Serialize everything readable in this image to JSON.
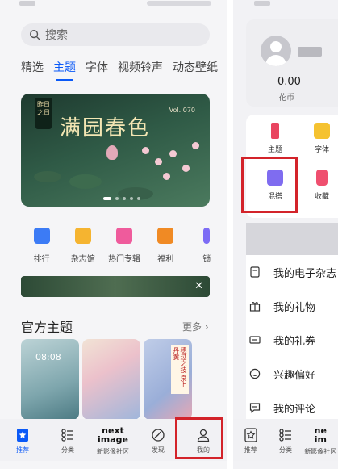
{
  "left": {
    "search": {
      "placeholder": "搜索"
    },
    "tabs": [
      {
        "label": "精选",
        "active": false
      },
      {
        "label": "主题",
        "active": true
      },
      {
        "label": "字体",
        "active": false
      },
      {
        "label": "视频铃声",
        "active": false
      },
      {
        "label": "动态壁纸",
        "active": false
      }
    ],
    "banner": {
      "tag": "昨日之日",
      "title": "满园春色",
      "volume": "Vol. 070",
      "page_count": 5,
      "active_page": 1
    },
    "shortcuts": [
      {
        "label": "排行",
        "icon": "ranking-icon",
        "color": "#3c7bf5"
      },
      {
        "label": "杂志馆",
        "icon": "magazine-icon",
        "color": "#f5b430"
      },
      {
        "label": "热门专辑",
        "icon": "album-icon",
        "color": "#ef5b9c"
      },
      {
        "label": "福利",
        "icon": "gift-icon",
        "color": "#f08a24"
      },
      {
        "label": "锁",
        "icon": "lock-icon",
        "color": "#7d6cf5"
      }
    ],
    "promo_strip": {
      "text": ""
    },
    "official": {
      "title": "官方主题",
      "more": "更多",
      "card1_clock": "08:08",
      "card3_poem": "穗过之技 泉上丹黄"
    },
    "bottom_nav": [
      {
        "label": "推荐",
        "icon": "recommend-icon",
        "active": true
      },
      {
        "label": "分类",
        "icon": "category-icon",
        "active": false
      },
      {
        "label": "新影像社区",
        "icon": "next-image-logo",
        "logo": "next\nimage",
        "active": false
      },
      {
        "label": "发现",
        "icon": "discover-icon",
        "active": false
      },
      {
        "label": "我的",
        "icon": "person-icon",
        "active": false
      }
    ]
  },
  "right": {
    "profile": {
      "coins_value": "0.00",
      "coins_label": "花币"
    },
    "grid": [
      {
        "label": "主题",
        "icon": "brush-icon",
        "color": "#e94560"
      },
      {
        "label": "字体",
        "icon": "font-icon",
        "color": "#f5c230"
      },
      {
        "label": "混搭",
        "icon": "mix-icon",
        "color": "#7f6cf0"
      },
      {
        "label": "收藏",
        "icon": "favorite-icon",
        "color": "#ef4f6f"
      }
    ],
    "menu": [
      {
        "label": "我的电子杂志",
        "icon": "ebook-icon"
      },
      {
        "label": "我的礼物",
        "icon": "gift-icon"
      },
      {
        "label": "我的礼券",
        "icon": "coupon-icon"
      },
      {
        "label": "兴趣偏好",
        "icon": "smile-icon"
      },
      {
        "label": "我的评论",
        "icon": "comment-icon"
      }
    ],
    "bottom_nav": [
      {
        "label": "推荐",
        "icon": "recommend-icon"
      },
      {
        "label": "分类",
        "icon": "category-icon"
      },
      {
        "label": "新影像社区",
        "icon": "next-image-logo",
        "logo": "next\nimage"
      }
    ]
  },
  "highlight_color": "#d3232a"
}
